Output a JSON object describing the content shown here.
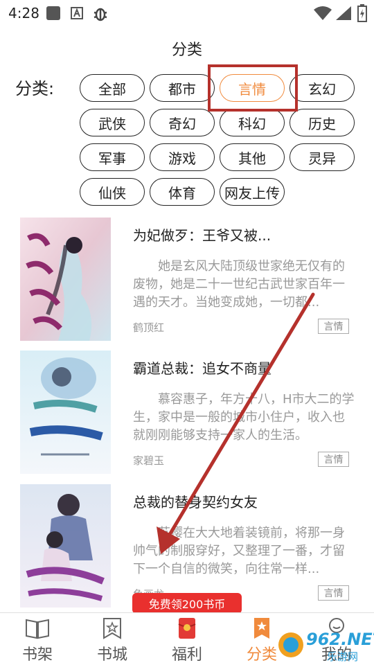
{
  "status": {
    "time": "4:28",
    "icons": [
      "square-icon",
      "a-box-icon",
      "bug-icon",
      "wifi-icon",
      "signal-icon",
      "battery-charging-icon"
    ]
  },
  "header": {
    "title": "分类"
  },
  "filter": {
    "label": "分类:",
    "chips": [
      "全部",
      "都市",
      "言情",
      "玄幻",
      "武侠",
      "奇幻",
      "科幻",
      "历史",
      "军事",
      "游戏",
      "其他",
      "灵异",
      "仙侠",
      "体育",
      "网友上传"
    ],
    "selected": "言情"
  },
  "books": [
    {
      "title": "为妃做歹：王爷又被...",
      "desc": "她是玄风大陆顶级世家绝无仅有的废物，她是二十一世纪古武世家百年一遇的天才。当她变成她，一切都...",
      "author": "鹤顶红",
      "tag": "言情"
    },
    {
      "title": "霸道总裁：追女不商量",
      "desc": "慕容惠子，年方十八，H市大二的学生，家中是一般的城市小住户，收入也就刚刚能够支持一家人的生活。",
      "author": "家碧玉",
      "tag": "言情"
    },
    {
      "title": "总裁的替身契约女友",
      "desc": "苏樱在大大地着装镜前，将那一身帅气的制服穿好，又整理了一番，才留下一个自信的微笑，向往常一样...",
      "author": "鱼画龙",
      "tag": "言情"
    }
  ],
  "promo": {
    "label": "免费领200书币"
  },
  "nav": {
    "items": [
      "书架",
      "书城",
      "福利",
      "分类",
      "我的"
    ],
    "active": "分类"
  },
  "watermark": {
    "text": "962.NET",
    "sub": "乐游网"
  },
  "colors": {
    "accent": "#f08a3c",
    "annotation": "#b5312c",
    "promo": "#e9302e"
  }
}
